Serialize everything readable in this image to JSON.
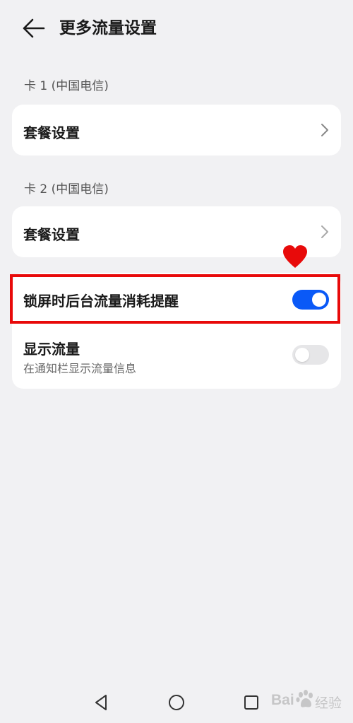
{
  "header": {
    "title": "更多流量设置",
    "back_icon": "arrow-left-icon"
  },
  "sections": [
    {
      "label": "卡 1 (中国电信)",
      "item_label": "套餐设置",
      "chevron_icon": "chevron-right-icon"
    },
    {
      "label": "卡 2 (中国电信)",
      "item_label": "套餐设置",
      "chevron_icon": "chevron-right-icon"
    }
  ],
  "settings": {
    "lockscreen_alert": {
      "label": "锁屏时后台流量消耗提醒",
      "enabled": true
    },
    "show_traffic": {
      "label": "显示流量",
      "description": "在通知栏显示流量信息",
      "enabled": false
    }
  },
  "annotation": {
    "highlight_color": "#e80a0a",
    "heart_icon": "heart-icon"
  },
  "navbar": {
    "back_icon": "triangle-back-icon",
    "home_icon": "circle-home-icon",
    "recents_icon": "square-recents-icon"
  },
  "watermark": {
    "text": "Bai",
    "suffix": "经验",
    "icon": "baidu-paw-icon"
  },
  "colors": {
    "background": "#f1f1f3",
    "card": "#ffffff",
    "accent": "#0a59f7",
    "toggle_off": "#e6e6e8"
  }
}
